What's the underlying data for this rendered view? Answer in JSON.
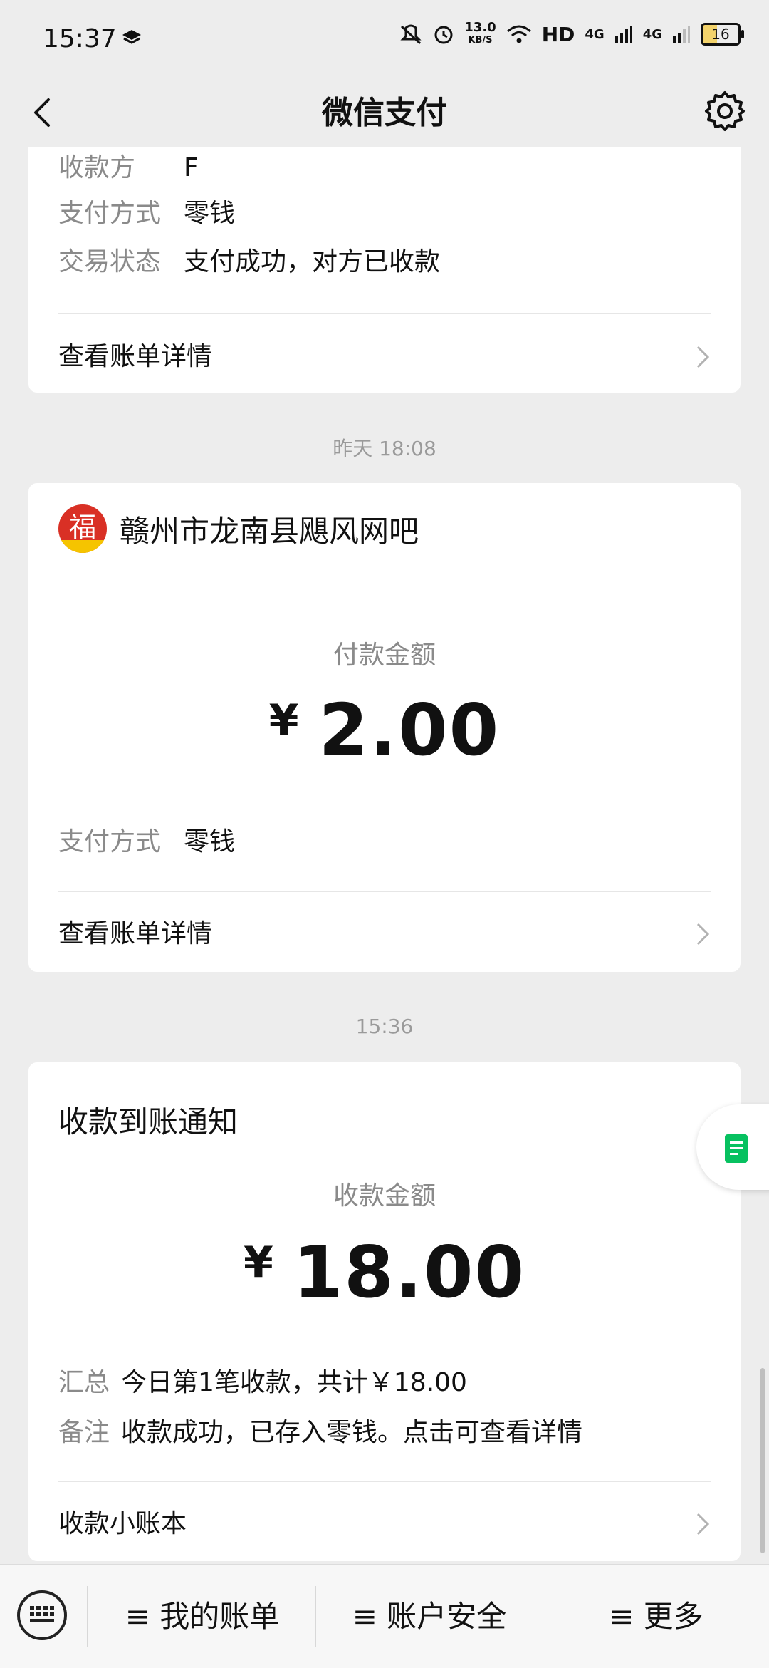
{
  "status_bar": {
    "time": "15:37",
    "net_speed_top": "13.0",
    "net_speed_bottom": "KB/S",
    "hd": "HD",
    "signal1": "4G",
    "signal2": "4G",
    "battery": "16"
  },
  "header": {
    "title": "微信支付"
  },
  "card1": {
    "payee_label": "收款方",
    "payee_value": "F",
    "method_label": "支付方式",
    "method_value": "零钱",
    "status_label": "交易状态",
    "status_value": "支付成功，对方已收款",
    "details_link": "查看账单详情"
  },
  "card2": {
    "time": "昨天 18:08",
    "merchant_logo_char": "福",
    "merchant_name": "赣州市龙南县飓风网吧",
    "amount_label": "付款金额",
    "currency": "¥",
    "amount": "2.00",
    "method_label": "支付方式",
    "method_value": "零钱",
    "details_link": "查看账单详情"
  },
  "card3": {
    "time": "15:36",
    "title": "收款到账通知",
    "amount_label": "收款金额",
    "currency": "¥",
    "amount": "18.00",
    "summary_label": "汇总",
    "summary_value": "今日第1笔收款，共计￥18.00",
    "note_label": "备注",
    "note_value": "收款成功，已存入零钱。点击可查看详情",
    "ledger_link": "收款小账本"
  },
  "bottom_tabs": [
    {
      "label": "≡ 我的账单"
    },
    {
      "label": "≡ 账户安全"
    },
    {
      "label": "≡ 更多"
    }
  ],
  "colors": {
    "background": "#ededed",
    "wechat_green": "#07c160",
    "secondary_text": "#8a8a8a"
  },
  "icons": [
    "back-arrow-icon",
    "gear-icon",
    "keyboard-icon",
    "chevron-right-icon",
    "document-icon"
  ]
}
